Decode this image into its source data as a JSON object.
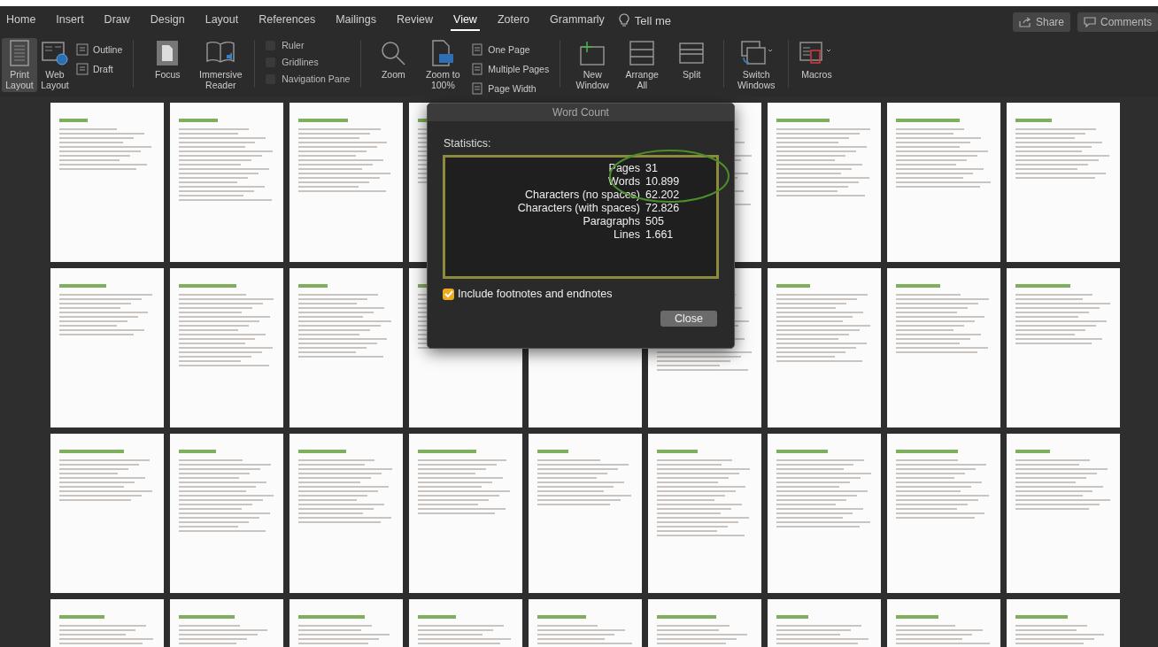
{
  "tabs": [
    {
      "label": "Home",
      "selected": false
    },
    {
      "label": "Insert",
      "selected": false
    },
    {
      "label": "Draw",
      "selected": false
    },
    {
      "label": "Design",
      "selected": false
    },
    {
      "label": "Layout",
      "selected": false
    },
    {
      "label": "References",
      "selected": false
    },
    {
      "label": "Mailings",
      "selected": false
    },
    {
      "label": "Review",
      "selected": false
    },
    {
      "label": "View",
      "selected": true
    },
    {
      "label": "Zotero",
      "selected": false
    },
    {
      "label": "Grammarly",
      "selected": false
    }
  ],
  "tell_me": "Tell me",
  "share": "Share",
  "comments": "Comments",
  "ribbon": {
    "views": [
      {
        "label": "Print Layout",
        "selected": true
      },
      {
        "label": "Web Layout",
        "selected": false
      }
    ],
    "views_small": [
      "Outline",
      "Draft"
    ],
    "immersive": [
      "Focus",
      "Immersive Reader"
    ],
    "show": [
      {
        "label": "Ruler",
        "checked": false
      },
      {
        "label": "Gridlines",
        "checked": false
      },
      {
        "label": "Navigation Pane",
        "checked": false
      }
    ],
    "zoom": [
      "Zoom",
      "Zoom to 100%"
    ],
    "zoom_small": [
      "One Page",
      "Multiple Pages",
      "Page Width"
    ],
    "window": [
      "New Window",
      "Arrange All",
      "Split"
    ],
    "switch_windows": "Switch Windows",
    "macros": "Macros"
  },
  "dialog": {
    "title": "Word Count",
    "heading": "Statistics:",
    "stats": [
      {
        "label": "Pages",
        "value": "31"
      },
      {
        "label": "Words",
        "value": "10.899"
      },
      {
        "label": "Characters (no spaces)",
        "value": "62.202"
      },
      {
        "label": "Characters (with spaces)",
        "value": "72.826"
      },
      {
        "label": "Paragraphs",
        "value": "505"
      },
      {
        "label": "Lines",
        "value": "1.661"
      }
    ],
    "include_footnotes": {
      "label": "Include footnotes and endnotes",
      "checked": true
    },
    "close": "Close"
  }
}
